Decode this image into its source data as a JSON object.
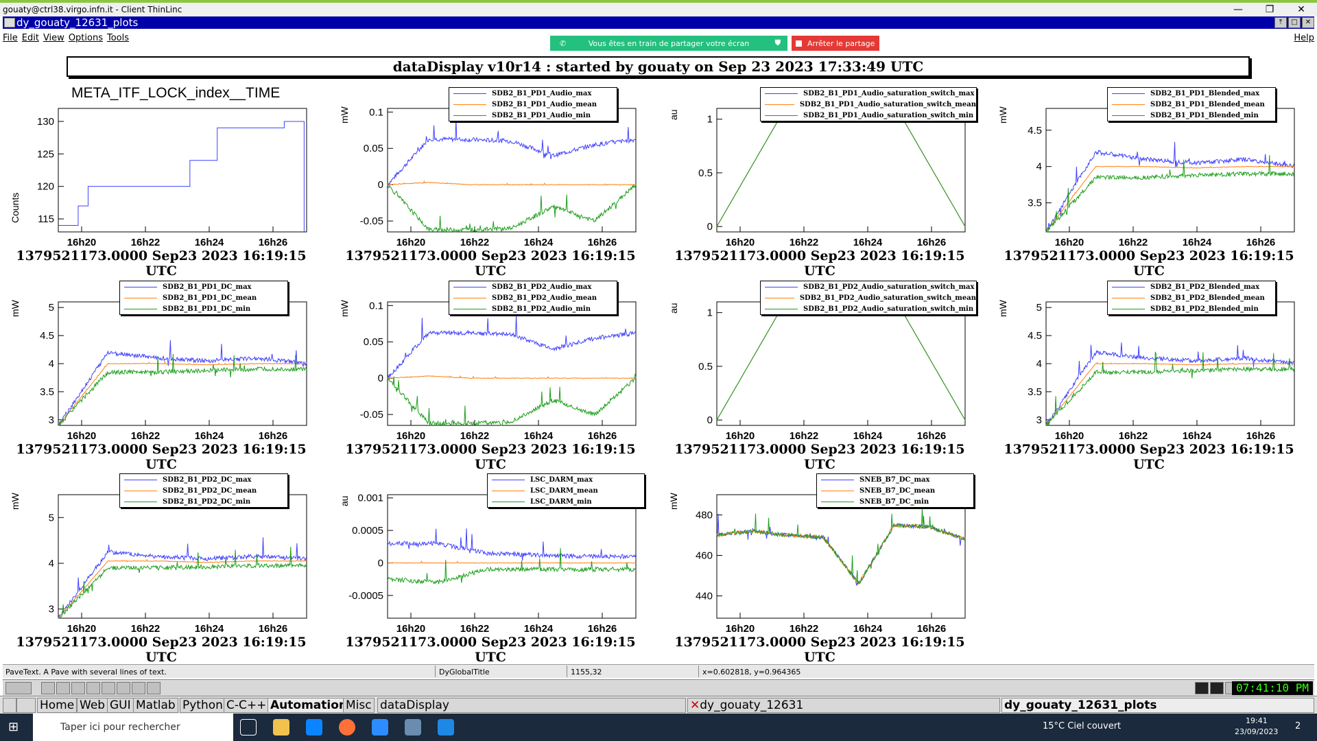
{
  "os_title": "gouaty@ctrl38.virgo.infn.it - Client ThinLinc",
  "app_title": "dy_gouaty_12631_plots",
  "menu": [
    "File",
    "Edit",
    "View",
    "Options",
    "Tools"
  ],
  "help": "Help",
  "share": {
    "message": "Vous êtes en train de partager votre écran",
    "stop": "Arrêter le partage"
  },
  "banner": "dataDisplay v10r14 : started by gouaty on Sep 23 2023 17:33:49 UTC",
  "footer_text": "1379521173.0000 Sep23 2023 16:19:15 UTC",
  "x_ticks": [
    "16h20",
    "16h22",
    "16h24",
    "16h26"
  ],
  "colors": {
    "max": "#4040ff",
    "mean": "#ff7f0e",
    "min": "#1a9e1a",
    "single": "#4040ff"
  },
  "panels": [
    {
      "title": "META_ITF_LOCK_index__TIME",
      "ylabel": "Counts",
      "yticks": [
        "130",
        "125",
        "120",
        "115"
      ],
      "legend": []
    },
    {
      "ylabel": "mW",
      "yticks": [
        "0.1",
        "0.05",
        "0",
        "-0.05"
      ],
      "legend": [
        "SDB2_B1_PD1_Audio_max",
        "SDB2_B1_PD1_Audio_mean",
        "SDB2_B1_PD1_Audio_min"
      ]
    },
    {
      "ylabel": "au",
      "yticks": [
        "1",
        "0.5",
        "0"
      ],
      "legend": [
        "SDB2_B1_PD1_Audio_saturation_switch_max",
        "SDB2_B1_PD1_Audio_saturation_switch_mean",
        "SDB2_B1_PD1_Audio_saturation_switch_min"
      ]
    },
    {
      "ylabel": "mW",
      "yticks": [
        "4.5",
        "4",
        "3.5"
      ],
      "legend": [
        "SDB2_B1_PD1_Blended_max",
        "SDB2_B1_PD1_Blended_mean",
        "SDB2_B1_PD1_Blended_min"
      ]
    },
    {
      "ylabel": "mW",
      "yticks": [
        "5",
        "4.5",
        "4",
        "3.5",
        "3"
      ],
      "legend": [
        "SDB2_B1_PD1_DC_max",
        "SDB2_B1_PD1_DC_mean",
        "SDB2_B1_PD1_DC_min"
      ]
    },
    {
      "ylabel": "mW",
      "yticks": [
        "0.1",
        "0.05",
        "0",
        "-0.05"
      ],
      "legend": [
        "SDB2_B1_PD2_Audio_max",
        "SDB2_B1_PD2_Audio_mean",
        "SDB2_B1_PD2_Audio_min"
      ]
    },
    {
      "ylabel": "au",
      "yticks": [
        "1",
        "0.5",
        "0"
      ],
      "legend": [
        "SDB2_B1_PD2_Audio_saturation_switch_max",
        "SDB2_B1_PD2_Audio_saturation_switch_mean",
        "SDB2_B1_PD2_Audio_saturation_switch_min"
      ]
    },
    {
      "ylabel": "mW",
      "yticks": [
        "5",
        "4.5",
        "4",
        "3.5",
        "3"
      ],
      "legend": [
        "SDB2_B1_PD2_Blended_max",
        "SDB2_B1_PD2_Blended_mean",
        "SDB2_B1_PD2_Blended_min"
      ]
    },
    {
      "ylabel": "mW",
      "yticks": [
        "5",
        "4",
        "3"
      ],
      "legend": [
        "SDB2_B1_PD2_DC_max",
        "SDB2_B1_PD2_DC_mean",
        "SDB2_B1_PD2_DC_min"
      ]
    },
    {
      "ylabel": "au",
      "yticks": [
        "0.001",
        "0.0005",
        "0",
        "-0.0005"
      ],
      "legend": [
        "LSC_DARM_max",
        "LSC_DARM_mean",
        "LSC_DARM_min"
      ]
    },
    {
      "ylabel": "mW",
      "yticks": [
        "480",
        "460",
        "440"
      ],
      "legend": [
        "SNEB_B7_DC_max",
        "SNEB_B7_DC_mean",
        "SNEB_B7_DC_min"
      ]
    }
  ],
  "chart_data": [
    {
      "type": "line",
      "title": "META_ITF_LOCK_index__TIME",
      "ylabel": "Counts",
      "x": [
        "16h19.8",
        "16h20.2",
        "16h20.4",
        "16h21.5",
        "16h23.5",
        "16h24.2",
        "16h25.9",
        "16h26.3"
      ],
      "series": [
        {
          "values": [
            114,
            117,
            120,
            120,
            124,
            129,
            130,
            130
          ]
        }
      ]
    },
    {
      "type": "line",
      "ylabel": "mW",
      "ylim": [
        -0.065,
        0.105
      ],
      "series": [
        {
          "name": "SDB2_B1_PD1_Audio_max",
          "values": [
            0.0,
            0.063,
            0.062,
            0.06,
            0.04,
            0.055,
            0.062
          ]
        },
        {
          "name": "SDB2_B1_PD1_Audio_mean",
          "values": [
            0.0,
            0.003,
            0.0,
            0.0,
            0.0,
            0.0,
            0.0
          ]
        },
        {
          "name": "SDB2_B1_PD1_Audio_min",
          "values": [
            0.0,
            -0.062,
            -0.062,
            -0.06,
            -0.03,
            -0.05,
            0.0
          ]
        }
      ]
    },
    {
      "type": "line",
      "ylabel": "au",
      "ylim": [
        -0.05,
        1.1
      ],
      "series": [
        {
          "name": "SDB2_B1_PD1_Audio_saturation_switch_max",
          "values": [
            0,
            1,
            1,
            1,
            0
          ]
        },
        {
          "name": "SDB2_B1_PD1_Audio_saturation_switch_mean",
          "values": [
            0,
            1,
            1,
            1,
            0
          ]
        },
        {
          "name": "SDB2_B1_PD1_Audio_saturation_switch_min",
          "values": [
            0,
            1,
            1,
            1,
            0
          ]
        }
      ]
    },
    {
      "type": "line",
      "ylabel": "mW",
      "ylim": [
        3.1,
        4.8
      ],
      "series": [
        {
          "name": "SDB2_B1_PD1_Blended_max",
          "values": [
            3.1,
            4.2,
            4.1,
            4.05,
            4.1,
            4.0
          ]
        },
        {
          "name": "SDB2_B1_PD1_Blended_mean",
          "values": [
            3.1,
            4.0,
            4.0,
            3.98,
            4.0,
            4.0
          ]
        },
        {
          "name": "SDB2_B1_PD1_Blended_min",
          "values": [
            3.1,
            3.85,
            3.85,
            3.88,
            3.9,
            3.9
          ]
        }
      ]
    },
    {
      "type": "line",
      "ylabel": "mW",
      "ylim": [
        2.9,
        5.1
      ],
      "series": [
        {
          "name": "SDB2_B1_PD1_DC_max",
          "values": [
            2.9,
            4.2,
            4.1,
            4.05,
            4.1,
            4.0
          ]
        },
        {
          "name": "SDB2_B1_PD1_DC_mean",
          "values": [
            2.9,
            4.0,
            4.0,
            3.98,
            4.0,
            4.0
          ]
        },
        {
          "name": "SDB2_B1_PD1_DC_min",
          "values": [
            2.9,
            3.85,
            3.85,
            3.88,
            3.9,
            3.9
          ]
        }
      ]
    },
    {
      "type": "line",
      "ylabel": "mW",
      "ylim": [
        -0.065,
        0.105
      ],
      "series": [
        {
          "name": "SDB2_B1_PD2_Audio_max",
          "values": [
            0.0,
            0.063,
            0.062,
            0.06,
            0.04,
            0.055,
            0.062
          ]
        },
        {
          "name": "SDB2_B1_PD2_Audio_mean",
          "values": [
            0.0,
            0.003,
            0.0,
            0.0,
            0.0,
            0.0,
            0.0
          ]
        },
        {
          "name": "SDB2_B1_PD2_Audio_min",
          "values": [
            0.0,
            -0.062,
            -0.062,
            -0.06,
            -0.03,
            -0.05,
            0.0
          ]
        }
      ]
    },
    {
      "type": "line",
      "ylabel": "au",
      "ylim": [
        -0.05,
        1.1
      ],
      "series": [
        {
          "name": "SDB2_B1_PD2_Audio_saturation_switch_max",
          "values": [
            0,
            1,
            1,
            1,
            0
          ]
        },
        {
          "name": "SDB2_B1_PD2_Audio_saturation_switch_mean",
          "values": [
            0,
            1,
            1,
            1,
            0
          ]
        },
        {
          "name": "SDB2_B1_PD2_Audio_saturation_switch_min",
          "values": [
            0,
            1,
            1,
            1,
            0
          ]
        }
      ]
    },
    {
      "type": "line",
      "ylabel": "mW",
      "ylim": [
        2.9,
        5.1
      ],
      "series": [
        {
          "name": "SDB2_B1_PD2_Blended_max",
          "values": [
            2.9,
            4.2,
            4.1,
            4.05,
            4.1,
            4.0
          ]
        },
        {
          "name": "SDB2_B1_PD2_Blended_mean",
          "values": [
            2.9,
            4.0,
            4.0,
            3.98,
            4.0,
            4.0
          ]
        },
        {
          "name": "SDB2_B1_PD2_Blended_min",
          "values": [
            2.9,
            3.85,
            3.85,
            3.88,
            3.9,
            3.9
          ]
        }
      ]
    },
    {
      "type": "line",
      "ylabel": "mW",
      "ylim": [
        2.8,
        5.5
      ],
      "series": [
        {
          "name": "SDB2_B1_PD2_DC_max",
          "values": [
            2.8,
            4.25,
            4.15,
            4.1,
            4.15,
            4.1
          ]
        },
        {
          "name": "SDB2_B1_PD2_DC_mean",
          "values": [
            2.8,
            4.05,
            4.05,
            4.02,
            4.05,
            4.05
          ]
        },
        {
          "name": "SDB2_B1_PD2_DC_min",
          "values": [
            2.8,
            3.9,
            3.9,
            3.92,
            3.95,
            3.95
          ]
        }
      ]
    },
    {
      "type": "line",
      "ylabel": "au",
      "ylim": [
        -0.00085,
        0.00105
      ],
      "series": [
        {
          "name": "LSC_DARM_max",
          "values": [
            0.0003,
            0.0003,
            0.00015,
            0.00012,
            0.0001,
            0.0001
          ]
        },
        {
          "name": "LSC_DARM_mean",
          "values": [
            0.0,
            0.0,
            0.0,
            0.0,
            0.0,
            0.0
          ]
        },
        {
          "name": "LSC_DARM_min",
          "values": [
            -0.00025,
            -0.0003,
            -0.0001,
            -0.0001,
            -0.0001,
            -0.0001
          ]
        }
      ]
    },
    {
      "type": "line",
      "ylabel": "mW",
      "ylim": [
        429,
        490
      ],
      "series": [
        {
          "name": "SNEB_B7_DC_max",
          "values": [
            470,
            472,
            470,
            469,
            446,
            475,
            474,
            468
          ]
        },
        {
          "name": "SNEB_B7_DC_mean",
          "values": [
            470,
            472,
            470,
            469,
            446,
            475,
            474,
            468
          ]
        },
        {
          "name": "SNEB_B7_DC_min",
          "values": [
            470,
            472,
            470,
            469,
            446,
            475,
            474,
            468
          ]
        }
      ]
    }
  ],
  "status": {
    "text": "PaveText. A Pave with several lines of text.",
    "object": "DyGlobalTitle",
    "pixel": "1155,32",
    "coords": "x=0.602818, y=0.964365"
  },
  "clock": "07:41:10 PM",
  "wm_tasks": [
    "Home",
    "Web",
    "GUI",
    "Matlab",
    "Python",
    "C-C++",
    "Automation",
    "Misc",
    "dataDisplay",
    "dy_gouaty_12631",
    "dy_gouaty_12631_plots"
  ],
  "win": {
    "search": "Taper ici pour rechercher",
    "weather": "15°C  Ciel couvert",
    "time": "19:41",
    "date": "23/09/2023",
    "notif": "2"
  }
}
